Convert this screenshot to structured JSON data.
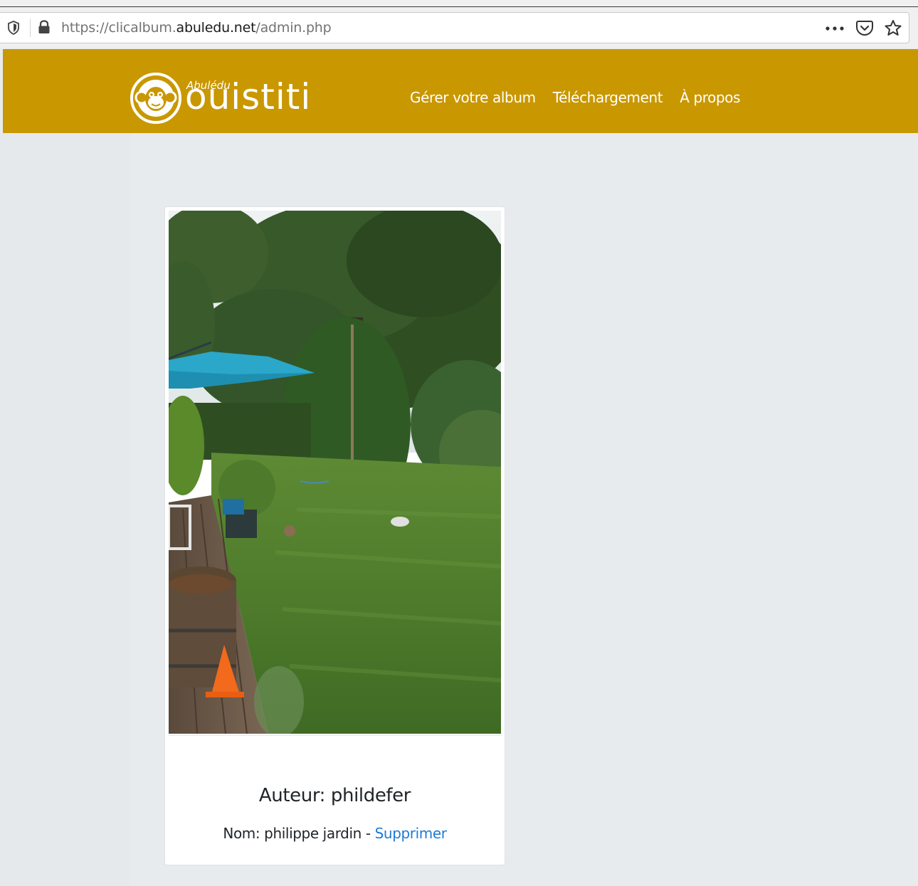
{
  "browser": {
    "url_prefix": "https://clicalbum.",
    "url_host": "abuledu.net",
    "url_path": "/admin.php"
  },
  "header": {
    "logo_small": "Abulédu",
    "logo_big": "ouistiti",
    "nav": [
      {
        "label": "Gérer votre album"
      },
      {
        "label": "Téléchargement"
      },
      {
        "label": "À propos"
      }
    ],
    "background_color": "#c99700"
  },
  "card": {
    "author": "Auteur: phildefer",
    "name": "Nom: philippe jardin",
    "separator": " - ",
    "delete_label": "Supprimer",
    "link_color": "#1e7bd6"
  }
}
